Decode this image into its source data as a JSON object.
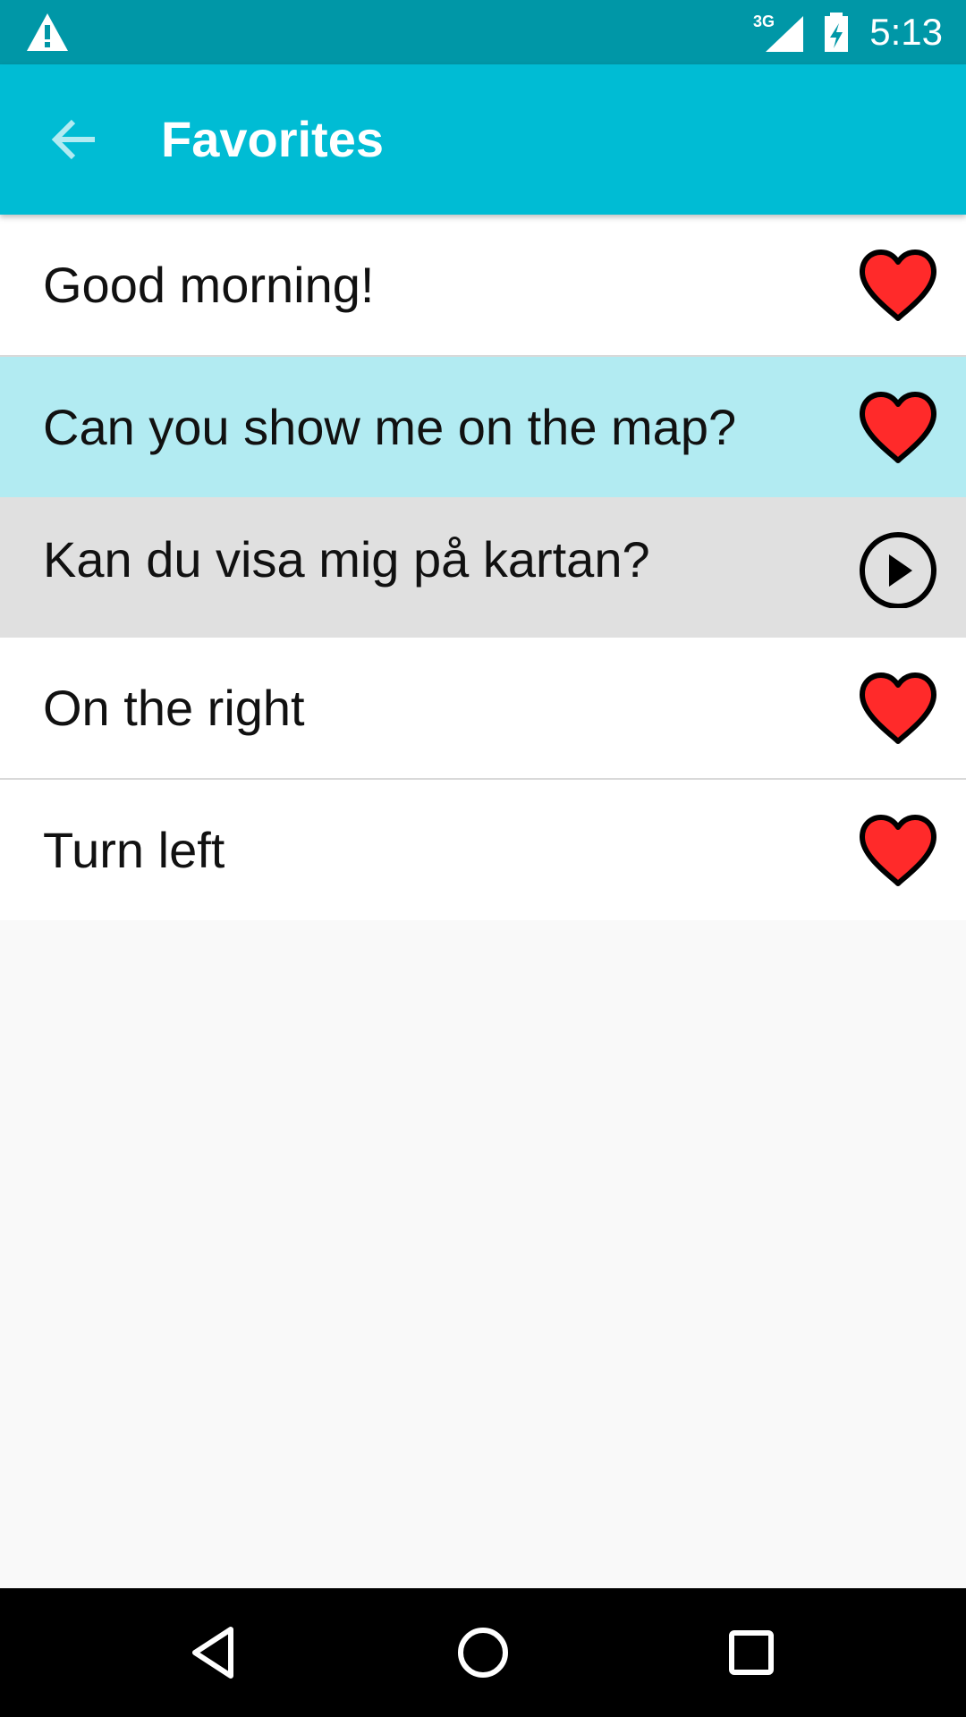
{
  "status_bar": {
    "time": "5:13",
    "network_label": "3G",
    "icons": [
      "warning-icon",
      "signal-3g-icon",
      "battery-charging-icon"
    ]
  },
  "app_bar": {
    "title": "Favorites",
    "back_icon": "arrow-left-icon"
  },
  "list": {
    "items": [
      {
        "text": "Good morning!",
        "action_icon": "heart-icon",
        "state": "normal"
      },
      {
        "text": "Can you show me on the map?",
        "action_icon": "heart-icon",
        "state": "selected"
      },
      {
        "text": "Kan du visa mig på kartan?",
        "action_icon": "play-icon",
        "state": "translation"
      },
      {
        "text": "On the right",
        "action_icon": "heart-icon",
        "state": "normal"
      },
      {
        "text": "Turn left",
        "action_icon": "heart-icon",
        "state": "normal"
      }
    ]
  },
  "nav_bar": {
    "icons": [
      "nav-back-icon",
      "nav-home-icon",
      "nav-recents-icon"
    ]
  },
  "colors": {
    "status_bar": "#0097a7",
    "app_bar": "#00bcd4",
    "selected_row": "#b2ebf2",
    "translation_row": "#e0e0e0",
    "heart": "#ff2a2a",
    "background": "#f9f9f9",
    "nav_bar": "#000000"
  }
}
